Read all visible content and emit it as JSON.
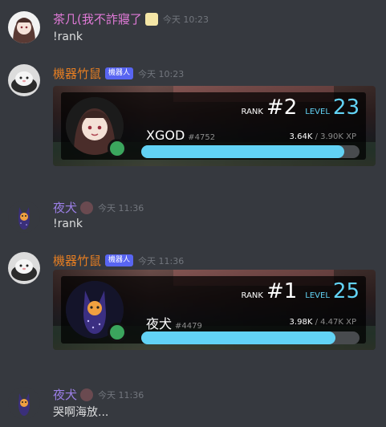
{
  "messages": [
    {
      "author": "茶几(我不詐寢了",
      "author_color": "#e07ad7",
      "time": "今天 10:23",
      "text": "!rank"
    },
    {
      "author": "機器竹鼠",
      "author_color": "#e67e22",
      "bot_tag": "機器人",
      "time": "今天 10:23",
      "rank_card": {
        "rank_label": "RANK",
        "rank": "#2",
        "level_label": "LEVEL",
        "level": "23",
        "username": "XGOD",
        "discriminator": "#4752",
        "xp_current": "3.64K",
        "xp_total": "/ 3.90K XP",
        "progress": 0.93
      }
    },
    {
      "author": "夜犬",
      "author_color": "#9b7fe6",
      "time": "今天 11:36",
      "text": "!rank"
    },
    {
      "author": "機器竹鼠",
      "author_color": "#e67e22",
      "bot_tag": "機器人",
      "time": "今天 11:36",
      "rank_card": {
        "rank_label": "RANK",
        "rank": "#1",
        "level_label": "LEVEL",
        "level": "25",
        "username": "夜犬",
        "discriminator": "#4479",
        "xp_current": "3.98K",
        "xp_total": "/ 4.47K XP",
        "progress": 0.89
      }
    },
    {
      "author": "夜犬",
      "author_color": "#9b7fe6",
      "time": "今天 11:36",
      "text": "哭啊海放..."
    }
  ],
  "colors": {
    "background": "#36393f",
    "accent_level": "#62d3f5",
    "status_online": "#3ba55d",
    "bot_tag_bg": "#5865f2"
  }
}
